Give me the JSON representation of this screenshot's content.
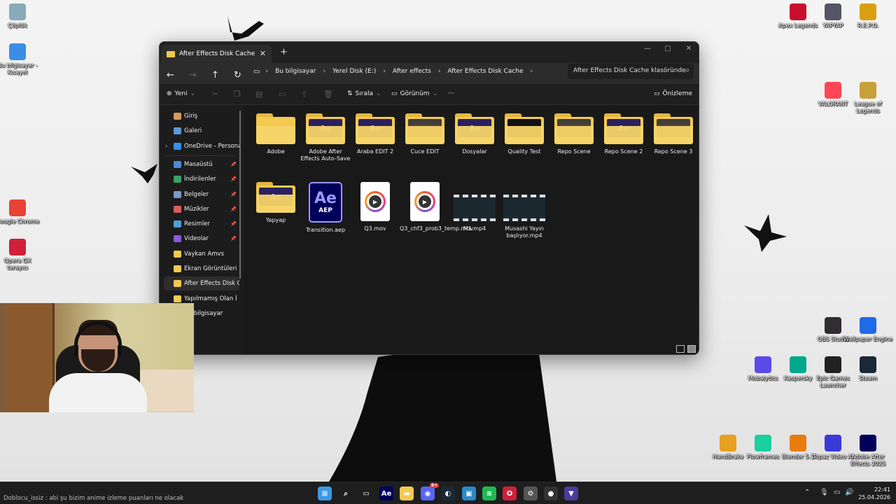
{
  "desktop": {
    "left_icons": [
      {
        "label": "Çöplük",
        "icon": "recycle-bin-icon"
      },
      {
        "label": "Bu bilgisayar - Kısayol",
        "icon": "this-pc-icon"
      },
      {
        "label": "Google Chrome",
        "icon": "chrome-icon"
      },
      {
        "label": "Opera GX tarayıcı",
        "icon": "opera-gx-icon"
      }
    ],
    "top_right_icons": [
      {
        "label": "Apex Legends",
        "icon": "apex-icon"
      },
      {
        "label": "YAPYAP",
        "icon": "yapyap-icon"
      },
      {
        "label": "R.E.P.O.",
        "icon": "repo-icon"
      },
      {
        "label": "VALORANT",
        "icon": "valorant-icon"
      },
      {
        "label": "League of Legends",
        "icon": "league-icon"
      }
    ],
    "bottom_right_icons": [
      {
        "label": "OBS Studio",
        "icon": "obs-icon"
      },
      {
        "label": "Wallpaper Engine",
        "icon": "wallpaper-engine-icon"
      },
      {
        "label": "Mobalytics",
        "icon": "mobalytics-icon"
      },
      {
        "label": "Kaspersky",
        "icon": "kaspersky-icon"
      },
      {
        "label": "Epic Games Launcher",
        "icon": "epic-icon"
      },
      {
        "label": "Steam",
        "icon": "steam-icon"
      },
      {
        "label": "HandBrake",
        "icon": "handbrake-icon"
      },
      {
        "label": "Flowframes",
        "icon": "flowframes-icon"
      },
      {
        "label": "Blender 5.1",
        "icon": "blender-icon"
      },
      {
        "label": "Topaz Video AI",
        "icon": "topaz-icon"
      },
      {
        "label": "Adobe After Effects 2025",
        "icon": "after-effects-icon"
      }
    ]
  },
  "explorer": {
    "tab_title": "After Effects Disk Cache",
    "breadcrumb": [
      "Bu bilgisayar",
      "Yerel Disk (E:)",
      "After effects",
      "After Effects Disk Cache"
    ],
    "search_placeholder": "After Effects Disk Cache klasöründe",
    "toolbar": {
      "new": "Yeni",
      "sort": "Sırala",
      "view": "Görünüm",
      "more": "···",
      "preview": "Önizleme"
    },
    "sidebar": {
      "top": [
        {
          "label": "Giriş",
          "color": "#d99a5a"
        },
        {
          "label": "Galeri",
          "color": "#5a9ad9"
        },
        {
          "label": "OneDrive - Personal",
          "color": "#3a8ee6"
        }
      ],
      "pinned": [
        {
          "label": "Masaüstü",
          "color": "#4a8ad8"
        },
        {
          "label": "İndirilenler",
          "color": "#3aa06a"
        },
        {
          "label": "Belgeler",
          "color": "#7a9ac8"
        },
        {
          "label": "Müzikler",
          "color": "#d8605a"
        },
        {
          "label": "Resimler",
          "color": "#4aa0d8"
        },
        {
          "label": "Videolar",
          "color": "#8a5ad8"
        }
      ],
      "folders": [
        {
          "label": "Vaykan Amvs"
        },
        {
          "label": "Ekran Görüntüleri"
        },
        {
          "label": "After Effects Disk Cache"
        },
        {
          "label": "Yapılmamış Olan İ"
        }
      ],
      "bottom": [
        {
          "label": "Bu bilgisayar"
        }
      ]
    },
    "files_row1": [
      {
        "name": "Adobe",
        "type": "folder",
        "preview": ""
      },
      {
        "name": "Adobe After Effects Auto-Save",
        "type": "folder",
        "preview": "Ae"
      },
      {
        "name": "Araba EDIT 2",
        "type": "folder",
        "preview": "Ae"
      },
      {
        "name": "Cuce EDIT",
        "type": "folder",
        "preview": "img"
      },
      {
        "name": "Dosyalar",
        "type": "folder",
        "preview": "Ae"
      },
      {
        "name": "Quality Test",
        "type": "folder",
        "preview": "dark"
      },
      {
        "name": "Repo Scene",
        "type": "folder",
        "preview": "img"
      },
      {
        "name": "Repo Scene 2",
        "type": "folder",
        "preview": "Ae"
      },
      {
        "name": "Repo Scene 3",
        "type": "folder",
        "preview": "img"
      }
    ],
    "files_row2": [
      {
        "name": "Yapyap",
        "type": "folder",
        "preview": "Ae"
      },
      {
        "name": "Transition.aep",
        "type": "aep"
      },
      {
        "name": "Q3.mov",
        "type": "mov"
      },
      {
        "name": "Q3_chf3_prob3_temp.mov",
        "type": "mov"
      },
      {
        "name": "M1.mp4",
        "type": "mp4"
      },
      {
        "name": "Musashi Yayın başlıyor.mp4",
        "type": "mp4"
      }
    ],
    "ae_badge": {
      "big": "Ae",
      "small": "AEP"
    }
  },
  "chat_overlay": "Doblocu_issiz : abi şu bizim anime izleme puanları ne olacak",
  "taskbar": {
    "apps": [
      {
        "name": "start-icon",
        "color": "#3a9ae8",
        "glyph": "⊞"
      },
      {
        "name": "search-icon",
        "color": "transparent",
        "glyph": "⌕"
      },
      {
        "name": "task-view-icon",
        "color": "transparent",
        "glyph": "▭"
      },
      {
        "name": "after-effects-icon",
        "color": "#00005b",
        "glyph": "Ae"
      },
      {
        "name": "file-explorer-icon",
        "color": "#f4c950",
        "glyph": "▬"
      },
      {
        "name": "discord-icon",
        "color": "#5865f2",
        "glyph": "◉"
      },
      {
        "name": "steam-icon",
        "color": "#1b2838",
        "glyph": "◐"
      },
      {
        "name": "monitor-icon",
        "color": "#2a8ac8",
        "glyph": "▣"
      },
      {
        "name": "spotify-icon",
        "color": "#1db954",
        "glyph": "≋"
      },
      {
        "name": "opera-gx-icon",
        "color": "#d0203a",
        "glyph": "O"
      },
      {
        "name": "settings-icon",
        "color": "#555",
        "glyph": "⚙"
      },
      {
        "name": "obs-icon",
        "color": "#333",
        "glyph": "●"
      },
      {
        "name": "vpn-icon",
        "color": "#4a3a9a",
        "glyph": "▼"
      }
    ],
    "discord_badge": "9+",
    "time": "22:41",
    "date": "25.04.2026"
  }
}
